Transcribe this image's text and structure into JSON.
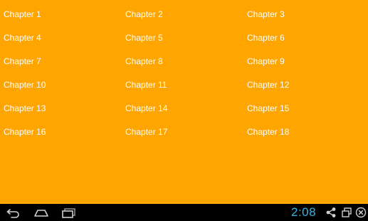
{
  "chapters": [
    "Chapter 1",
    "Chapter 2",
    "Chapter 3",
    "Chapter 4",
    "Chapter 5",
    "Chapter 6",
    "Chapter 7",
    "Chapter 8",
    "Chapter 9",
    "Chapter 10",
    "Chapter 11",
    "Chapter 12",
    "Chapter 13",
    "Chapter 14",
    "Chapter 15",
    "Chapter 16",
    "Chapter 17",
    "Chapter 18"
  ],
  "status_bar": {
    "clock": "2:08"
  },
  "icons": {
    "back": "back-icon",
    "home": "home-icon",
    "recents": "recent-apps-icon",
    "share": "share-icon",
    "window": "window-icon",
    "close": "close-icon"
  },
  "colors": {
    "background": "#FFA500",
    "text": "#FFFFFF",
    "nav_bar": "#000000",
    "clock": "#33B5E5"
  }
}
